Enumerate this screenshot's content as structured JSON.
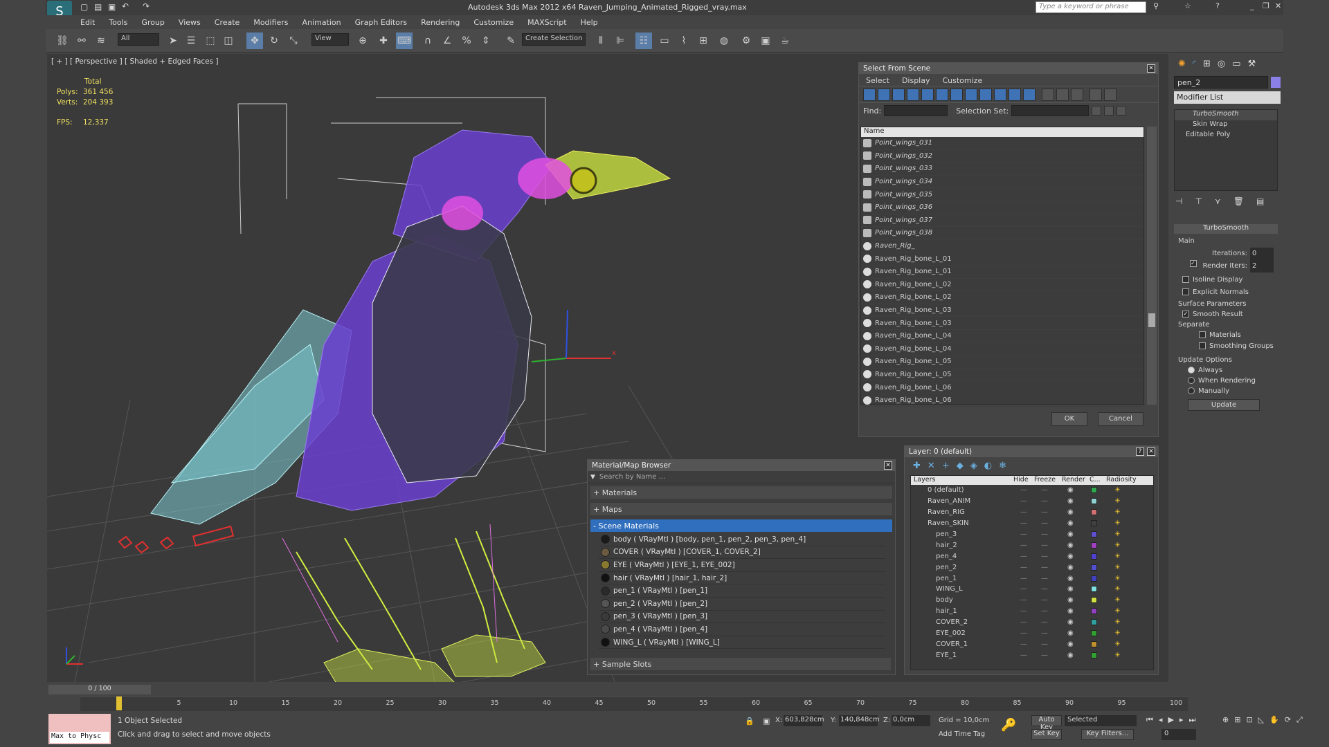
{
  "window": {
    "title": "Autodesk 3ds Max  2012 x64      Raven_Jumping_Animated_Rigged_vray.max",
    "search_placeholder": "Type a keyword or phrase"
  },
  "menu": [
    "Edit",
    "Tools",
    "Group",
    "Views",
    "Create",
    "Modifiers",
    "Animation",
    "Graph Editors",
    "Rendering",
    "Customize",
    "MAXScript",
    "Help"
  ],
  "toolbar": {
    "selection_filter": "All",
    "ref_coord": "View",
    "selection_set": "Create Selection Se"
  },
  "viewport": {
    "label": "[ + ] [ Perspective ] [ Shaded + Edged Faces ]",
    "stats": {
      "total_label": "Total",
      "polys_label": "Polys:",
      "polys": "361 456",
      "verts_label": "Verts:",
      "verts": "204 393",
      "fps_label": "FPS:",
      "fps": "12,337"
    },
    "axis_x": "x"
  },
  "select_from_scene": {
    "title": "Select From Scene",
    "menu": [
      "Select",
      "Display",
      "Customize"
    ],
    "find_label": "Find:",
    "selection_set_label": "Selection Set:",
    "column_name": "Name",
    "items": [
      "Point_wings_031",
      "Point_wings_032",
      "Point_wings_033",
      "Point_wings_034",
      "Point_wings_035",
      "Point_wings_036",
      "Point_wings_037",
      "Point_wings_038",
      "Raven_Rig_",
      "Raven_Rig_bone_L_01",
      "Raven_Rig_bone_L_01",
      "Raven_Rig_bone_L_02",
      "Raven_Rig_bone_L_02",
      "Raven_Rig_bone_L_03",
      "Raven_Rig_bone_L_03",
      "Raven_Rig_bone_L_04",
      "Raven_Rig_bone_L_04",
      "Raven_Rig_bone_L_05",
      "Raven_Rig_bone_L_05",
      "Raven_Rig_bone_L_06",
      "Raven_Rig_bone_L_06"
    ],
    "ok": "OK",
    "cancel": "Cancel"
  },
  "material_browser": {
    "title": "Material/Map Browser",
    "search_placeholder": "Search by Name ...",
    "sections": [
      "+ Materials",
      "+ Maps",
      "- Scene Materials"
    ],
    "materials": [
      {
        "label": "body  ( VRayMtl ) [body, pen_1, pen_2, pen_3, pen_4]",
        "color": "#1a1a1a"
      },
      {
        "label": "COVER  ( VRayMtl ) [COVER_1, COVER_2]",
        "color": "#6a5a40"
      },
      {
        "label": "EYE  ( VRayMtl ) [EYE_1, EYE_002]",
        "color": "#8a7a30"
      },
      {
        "label": "hair  ( VRayMtl ) [hair_1, hair_2]",
        "color": "#111111"
      },
      {
        "label": "pen_1  ( VRayMtl ) [pen_1]",
        "color": "#2a2a2a"
      },
      {
        "label": "pen_2  ( VRayMtl ) [pen_2]",
        "color": "#555555"
      },
      {
        "label": "pen_3  ( VRayMtl ) [pen_3]",
        "color": "#3a3a3a"
      },
      {
        "label": "pen_4  ( VRayMtl ) [pen_4]",
        "color": "#4a4a4a"
      },
      {
        "label": "WING_L  ( VRayMtl ) [WING_L]",
        "color": "#111111"
      }
    ],
    "sample_slots": "+ Sample Slots"
  },
  "layer_manager": {
    "title": "Layer: 0 (default)",
    "columns": [
      "Layers",
      "Hide",
      "Freeze",
      "Render",
      "C...",
      "Radiosity"
    ],
    "layers": [
      {
        "name": "0 (default)",
        "color": "#2fa84f"
      },
      {
        "name": "Raven_ANIM",
        "color": "#8fd0d0"
      },
      {
        "name": "Raven_RIG",
        "color": "#d07070"
      },
      {
        "name": "Raven_SKIN",
        "color": "#404040"
      },
      {
        "name": "pen_3",
        "color": "#6050d0"
      },
      {
        "name": "hair_2",
        "color": "#a040c0"
      },
      {
        "name": "pen_4",
        "color": "#5040d0"
      },
      {
        "name": "pen_2",
        "color": "#5050d0"
      },
      {
        "name": "pen_1",
        "color": "#4040c0"
      },
      {
        "name": "WING_L",
        "color": "#80e0e0"
      },
      {
        "name": "body",
        "color": "#d0e040"
      },
      {
        "name": "hair_1",
        "color": "#9040c0"
      },
      {
        "name": "COVER_2",
        "color": "#30a0a0"
      },
      {
        "name": "EYE_002",
        "color": "#30a030"
      },
      {
        "name": "COVER_1",
        "color": "#c09030"
      },
      {
        "name": "EYE_1",
        "color": "#30a030"
      }
    ]
  },
  "command_panel": {
    "object_name": "pen_2",
    "modifier_list": "Modifier List",
    "stack": [
      "TurboSmooth",
      "Skin Wrap",
      "Editable Poly"
    ],
    "rollout_title": "TurboSmooth",
    "main_label": "Main",
    "iterations_label": "Iterations:",
    "iterations": "0",
    "render_iters_label": "Render Iters:",
    "render_iters": "2",
    "isoline": "Isoline Display",
    "explicit": "Explicit Normals",
    "surface_params": "Surface Parameters",
    "smooth_result": "Smooth Result",
    "separate": "Separate",
    "materials": "Materials",
    "smoothing_groups": "Smoothing Groups",
    "update_options": "Update Options",
    "always": "Always",
    "when_rendering": "When Rendering",
    "manually": "Manually",
    "update_button": "Update"
  },
  "timeline": {
    "frame": "0 / 100",
    "ticks": [
      "5",
      "10",
      "15",
      "20",
      "25",
      "30",
      "35",
      "40",
      "45",
      "50",
      "55",
      "60",
      "65",
      "70",
      "75",
      "80",
      "85",
      "90",
      "95",
      "100"
    ]
  },
  "status": {
    "maxscript": "Max to Physc",
    "selected": "1 Object Selected",
    "prompt": "Click and drag to select and move objects",
    "x_label": "X:",
    "x": "603,828cm",
    "y_label": "Y:",
    "y": "140,848cm",
    "z_label": "Z:",
    "z": "0,0cm",
    "grid": "Grid = 10,0cm",
    "add_time_tag": "Add Time Tag",
    "auto_key": "Auto Key",
    "set_key": "Set Key",
    "selected_mode": "Selected",
    "key_filters": "Key Filters...",
    "current_frame": "0"
  }
}
